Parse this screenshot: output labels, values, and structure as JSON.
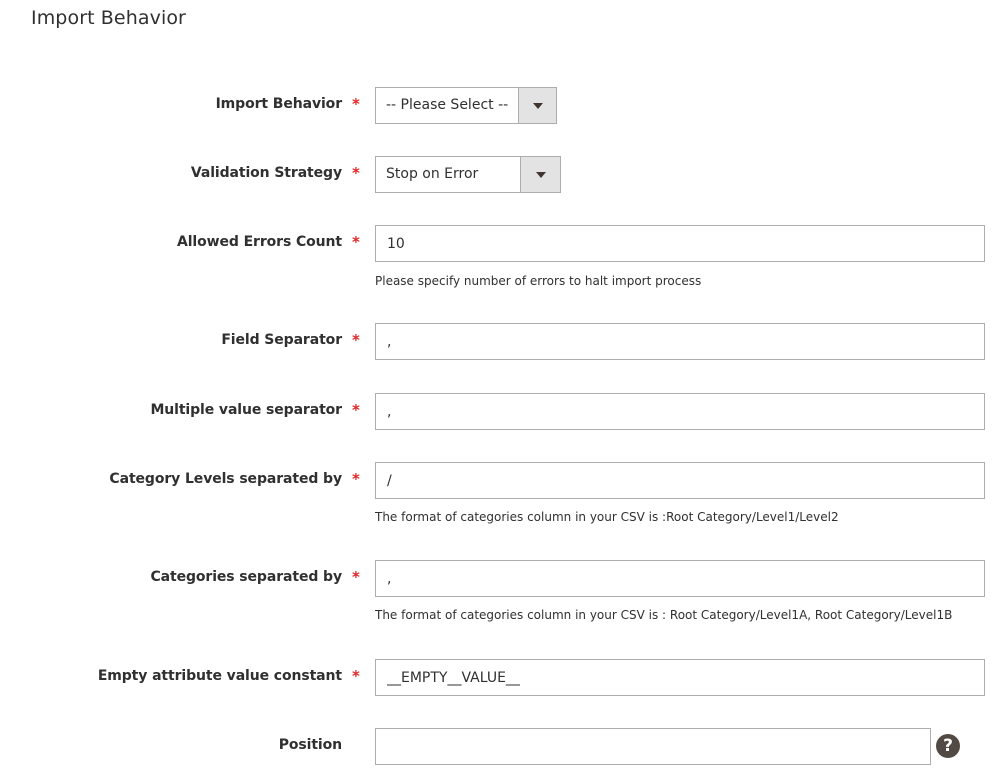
{
  "section": {
    "title": "Import Behavior"
  },
  "fields": {
    "import_behavior": {
      "label": "Import Behavior",
      "required": "*",
      "value": "-- Please Select --"
    },
    "validation_strategy": {
      "label": "Validation Strategy",
      "required": "*",
      "value": "Stop on Error"
    },
    "allowed_errors_count": {
      "label": "Allowed Errors Count",
      "required": "*",
      "value": "10",
      "note": "Please specify number of errors to halt import process"
    },
    "field_separator": {
      "label": "Field Separator",
      "required": "*",
      "value": ","
    },
    "multiple_value_separator": {
      "label": "Multiple value separator",
      "required": "*",
      "value": ","
    },
    "category_levels_separator": {
      "label": "Category Levels separated by",
      "required": "*",
      "value": "/",
      "note": "The format of categories column in your CSV is :Root Category/Level1/Level2"
    },
    "categories_separator": {
      "label": "Categories separated by",
      "required": "*",
      "value": ",",
      "note": "The format of categories column in your CSV is : Root Category/Level1A, Root Category/Level1B"
    },
    "empty_attribute_value": {
      "label": "Empty attribute value constant",
      "required": "*",
      "value": "__EMPTY__VALUE__"
    },
    "position": {
      "label": "Position",
      "value": "",
      "help_icon": "?"
    }
  },
  "colors": {
    "required": "#e22626",
    "help_icon_bg": "#514943",
    "border": "#adadad"
  }
}
